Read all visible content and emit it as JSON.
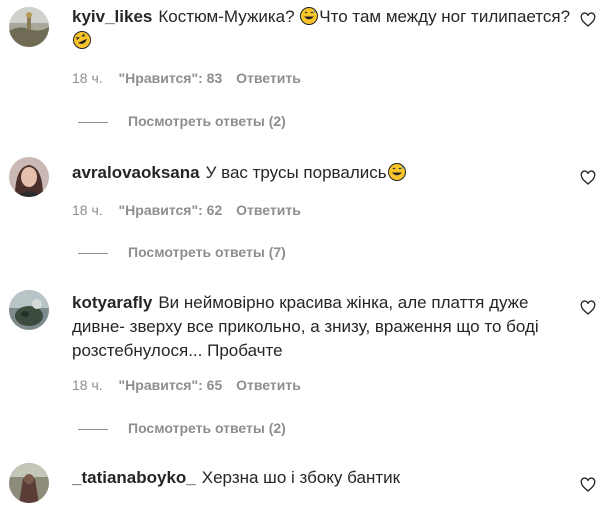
{
  "comments": [
    {
      "username": "kyiv_likes",
      "text_before": "Костюм-Мужика? ",
      "text_middle": "Что там между ног тилипается? ",
      "emoji_1": "grinning-sweat-face",
      "emoji_2": "rolling-on-floor-laughing-face",
      "time": "18 ч.",
      "likes": "\"Нравится\": 83",
      "reply": "Ответить",
      "view_replies": "Посмотреть ответы (2)"
    },
    {
      "username": "avralovaoksana",
      "text_before": "У вас трусы порвались",
      "emoji_1": "grinning-sweat-face",
      "time": "18 ч.",
      "likes": "\"Нравится\": 62",
      "reply": "Ответить",
      "view_replies": "Посмотреть ответы (7)"
    },
    {
      "username": "kotyarafly",
      "text_before": "Ви неймовірно красива жінка, але плаття дуже дивне- зверху все прикольно, а знизу, враження що то боді розстебнулося... Пробачте",
      "time": "18 ч.",
      "likes": "\"Нравится\": 65",
      "reply": "Ответить",
      "view_replies": "Посмотреть ответы (2)"
    },
    {
      "username": "_tatianaboyko_",
      "text_before": "Херзна шо і збоку бантик"
    }
  ],
  "colors": {
    "text": "#262626",
    "secondary": "#8e8e8e",
    "background": "#ffffff"
  }
}
